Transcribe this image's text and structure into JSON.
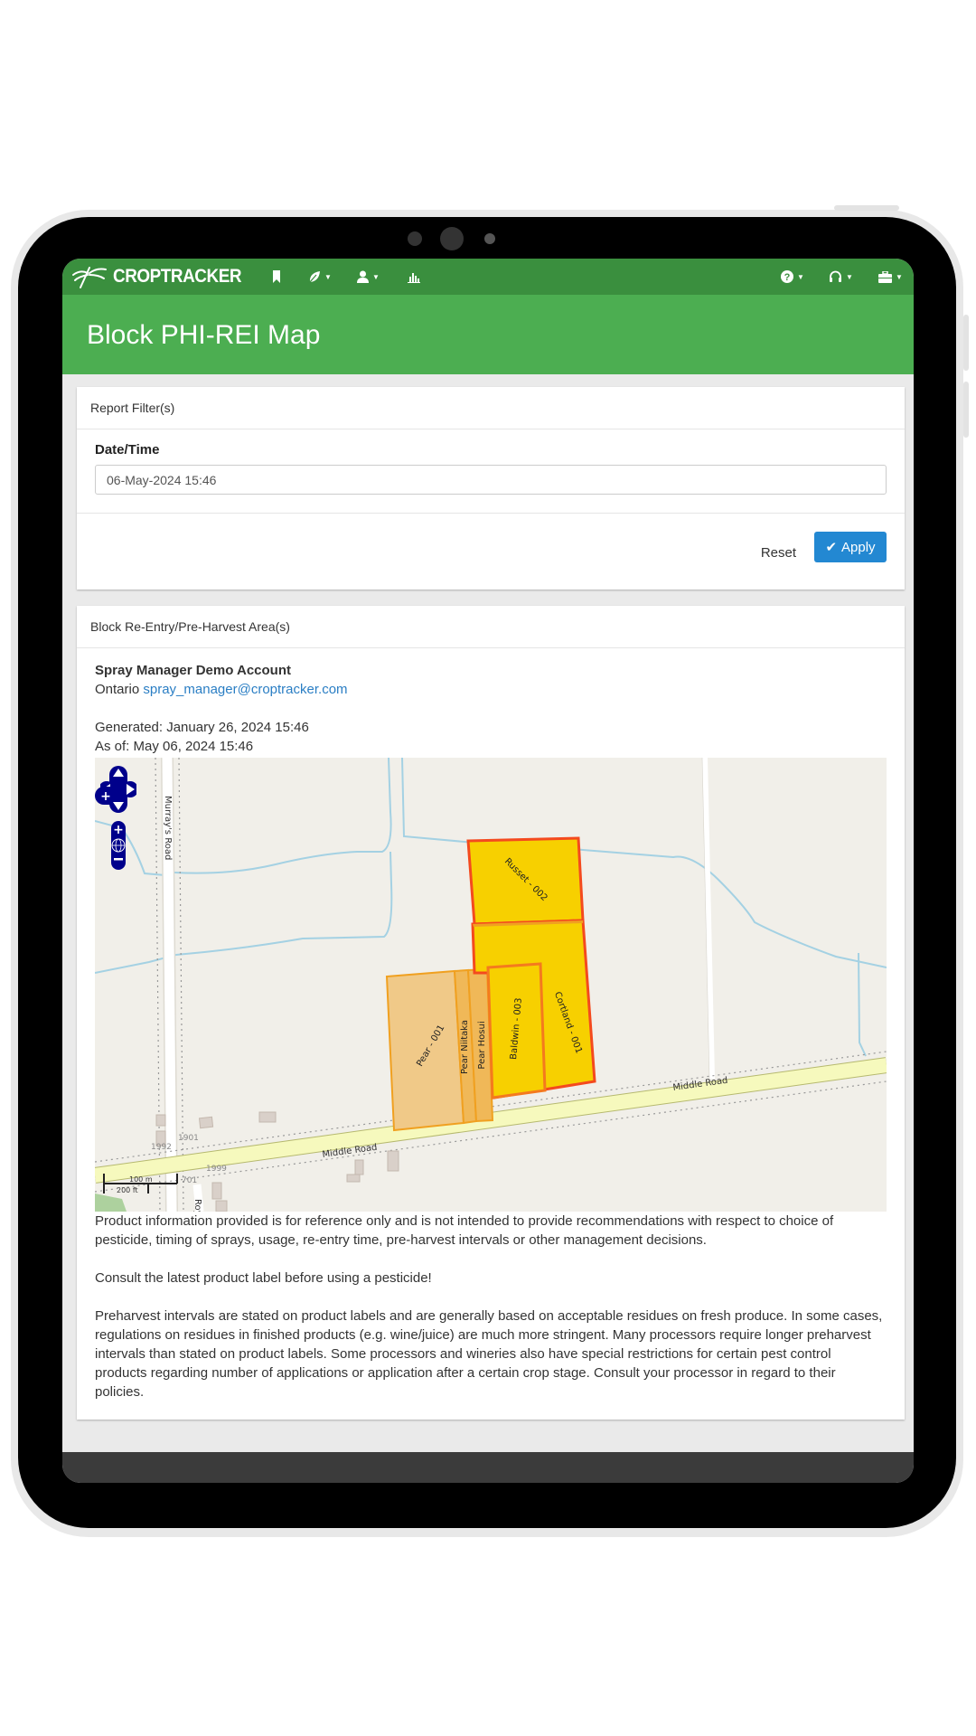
{
  "navbar": {
    "brand": "CROPTRACKER",
    "items": [
      {
        "icon": "bookmark-icon",
        "has_caret": false
      },
      {
        "icon": "leaf-icon",
        "has_caret": true
      },
      {
        "icon": "user-icon",
        "has_caret": true
      },
      {
        "icon": "bar-chart-icon",
        "has_caret": false
      }
    ],
    "right_items": [
      {
        "icon": "help-icon",
        "has_caret": true
      },
      {
        "icon": "headset-icon",
        "has_caret": true
      },
      {
        "icon": "briefcase-icon",
        "has_caret": true
      }
    ]
  },
  "header": {
    "title": "Block PHI-REI Map"
  },
  "filters": {
    "heading": "Report Filter(s)",
    "date_label": "Date/Time",
    "date_value": "06-May-2024 15:46",
    "reset_label": "Reset",
    "apply_label": "Apply"
  },
  "areas": {
    "heading": "Block Re-Entry/Pre-Harvest Area(s)",
    "account_name": "Spray Manager Demo Account",
    "region": "Ontario",
    "email": "spray_manager@croptracker.com",
    "generated": "Generated: January 26, 2024 15:46",
    "as_of": "As of: May 06, 2024 15:46"
  },
  "map": {
    "roads": [
      "Murray's Road",
      "Middle Road",
      "Middle Road",
      "Roys"
    ],
    "address_numbers": [
      "1901",
      "1992",
      "1999",
      "701"
    ],
    "scale_metric": "100 m",
    "scale_imperial": "200 ft",
    "blocks": [
      {
        "name": "Russet - 002",
        "status": "active"
      },
      {
        "name": "Cortland - 001",
        "status": "active"
      },
      {
        "name": "Baldwin - 003",
        "status": "active"
      },
      {
        "name": "Pear - 001",
        "status": "inactive"
      },
      {
        "name": "Pear Niitaka",
        "status": "inactive"
      },
      {
        "name": "Pear Hosui",
        "status": "inactive"
      }
    ],
    "colors": {
      "active_fill": "#f7d000",
      "active_stroke": "#f44a1e",
      "inactive_fill": "#f0c988",
      "inactive_stroke": "#f0a020",
      "water": "#a4d1e3",
      "road_major": "#f6f9bd",
      "land": "#f1efe9",
      "control": "#00008b"
    }
  },
  "disclaimer": [
    "Product information provided is for reference only and is not intended to provide recommendations with respect to choice of pesticide, timing of sprays, usage, re-entry time, pre-harvest intervals or other management decisions.",
    "Consult the latest product label before using a pesticide!",
    "Preharvest intervals are stated on product labels and are generally based on acceptable residues on fresh produce. In some cases, regulations on residues in finished products (e.g. wine/juice) are much more stringent. Many processors require longer preharvest intervals than stated on product labels. Some processors and wineries also have special restrictions for certain pest control products regarding number of applications or application after a certain crop stage. Consult your processor in regard to their policies."
  ],
  "colors": {
    "nav_green": "#3a8f3e",
    "header_green": "#4cae51",
    "apply_blue": "#2388d2",
    "link_blue": "#2a7ec4"
  }
}
